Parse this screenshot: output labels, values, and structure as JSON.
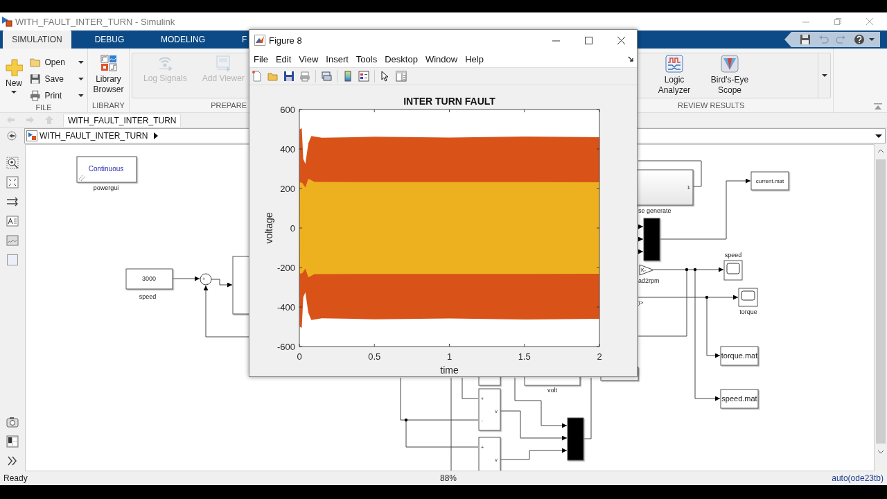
{
  "window": {
    "title": "WITH_FAULT_INTER_TURN - Simulink"
  },
  "ribbon_tabs": [
    {
      "label": "SIMULATION",
      "selected": true
    },
    {
      "label": "DEBUG",
      "selected": false
    },
    {
      "label": "MODELING",
      "selected": false
    },
    {
      "label": "F",
      "selected": false
    }
  ],
  "ribbon_groups": [
    {
      "label": "FILE",
      "buttons": [
        {
          "kind": "large",
          "label": "New",
          "menu": true,
          "disabled": false
        },
        {
          "kind": "small",
          "label": "Open",
          "menu": true,
          "disabled": false
        },
        {
          "kind": "small",
          "label": "Save",
          "menu": true,
          "disabled": false
        },
        {
          "kind": "small",
          "label": "Print",
          "menu": true,
          "disabled": false
        }
      ]
    },
    {
      "label": "LIBRARY",
      "buttons": [
        {
          "kind": "large",
          "label": "Library Browser",
          "menu": false,
          "disabled": false
        }
      ]
    },
    {
      "label": "PREPARE",
      "buttons": [
        {
          "kind": "large",
          "label": "Log Signals",
          "menu": false,
          "disabled": true
        },
        {
          "kind": "large",
          "label": "Add Viewer",
          "menu": false,
          "disabled": true
        }
      ]
    },
    {
      "label": "REVIEW RESULTS",
      "buttons": [
        {
          "kind": "large",
          "label": "Logic Analyzer",
          "menu": false,
          "disabled": false
        },
        {
          "kind": "large",
          "label": "Bird's-Eye Scope",
          "menu": false,
          "disabled": false
        }
      ]
    }
  ],
  "model_tabs": [
    {
      "label": "WITH_FAULT_INTER_TURN",
      "selected": true
    }
  ],
  "address": {
    "path": "WITH_FAULT_INTER_TURN"
  },
  "diagram": {
    "powergui": {
      "mode": "Continuous",
      "label": "powergui"
    },
    "constant": {
      "value": "3000",
      "label": "speed"
    },
    "sum": {
      "signs": [
        "+",
        "-"
      ]
    },
    "pulse_block": {
      "port": "1",
      "label": "se generate"
    },
    "gain": {
      "value": "K-",
      "label": "ad2rpm"
    },
    "signal_tag": ")>",
    "scopes": [
      {
        "label": "speed"
      },
      {
        "label": "torque"
      }
    ],
    "to_file_blocks": [
      {
        "file": "current.mat"
      },
      {
        "file": "torque.mat"
      },
      {
        "file": "speed.mat"
      }
    ],
    "volt_label": "volt",
    "measurement_blocks": [
      {
        "ports": [
          "+",
          "-"
        ],
        "output": "v"
      },
      {
        "ports": [
          "+"
        ],
        "output": "v"
      }
    ]
  },
  "figure": {
    "title": "Figure 8",
    "menu": [
      "File",
      "Edit",
      "View",
      "Insert",
      "Tools",
      "Desktop",
      "Window",
      "Help"
    ],
    "plot": {
      "title": "INTER TURN FAULT",
      "xlabel": "time",
      "ylabel": "voltage",
      "xticks": [
        "0",
        "0.5",
        "1",
        "1.5",
        "2"
      ],
      "yticks": [
        "600",
        "400",
        "200",
        "0",
        "-200",
        "-400",
        "-600"
      ]
    }
  },
  "status_bar": {
    "state": "Ready",
    "zoom": "88%",
    "solver": "auto(ode23tb)"
  }
}
